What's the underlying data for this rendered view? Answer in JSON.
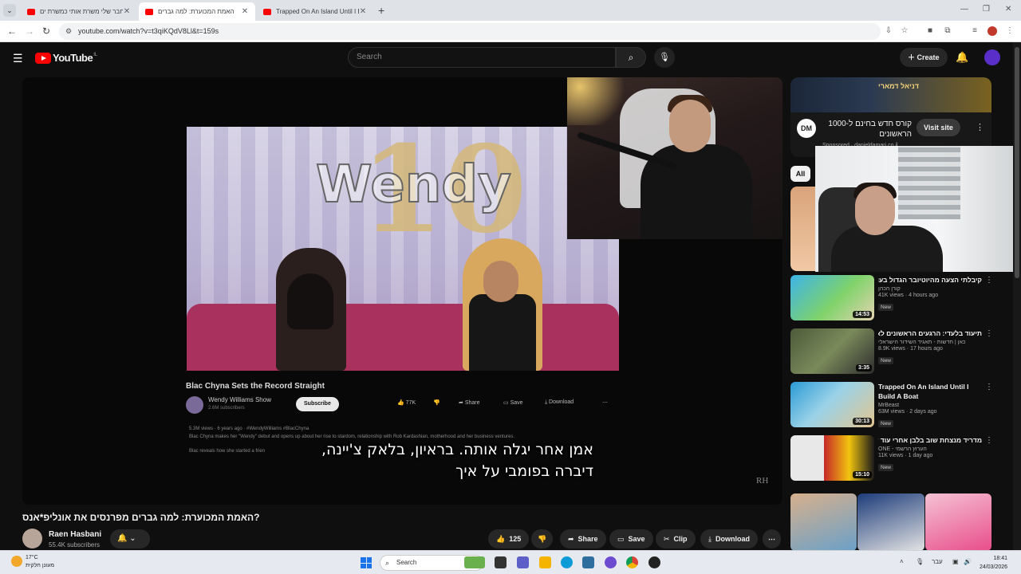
{
  "browser": {
    "tabs": [
      {
        "title": "חבר שלי משרת אותי כמשרת ים",
        "active": false
      },
      {
        "title": "האמת המכוערת: למה גברים",
        "active": true
      },
      {
        "title": "Trapped On An Island Until I Bu",
        "active": false
      }
    ],
    "url": "youtube.com/watch?v=t3qiKQdV8Ll&t=159s"
  },
  "youtube": {
    "logo_text": "YouTube",
    "country_code": "IL",
    "search_placeholder": "Search",
    "create_label": "Create"
  },
  "player": {
    "inner_video_title": "Blac Chyna Sets the Record Straight",
    "inner_channel": "Wendy Williams Show",
    "inner_subs": "2.6M subscribers",
    "inner_subscribe": "Subscribe",
    "inner_likes": "77K",
    "inner_share": "Share",
    "inner_save": "Save",
    "inner_download": "Download",
    "inner_views": "5.3M views · 6 years ago · #WendyWilliams #BlacChyna",
    "inner_desc1": "Blac Chyna makes her \"Wendy\" debut and opens up about her rise to stardom, relationship with Rob Kardashian, motherhood and her business ventures.",
    "inner_desc2": "Blac reveals how she started a frien",
    "caption_line1": "אמן אחר יגלה אותה.  בראיון, בלאק צ'יינה,",
    "caption_line2": "דיברה בפומבי על איך",
    "stage_number": "10",
    "stage_show": "Wendy",
    "watermark": "RH"
  },
  "video": {
    "title": "האמת המכוערת: למה גברים מפרנסים את אונליפ*אנס?",
    "channel": "Raen Hasbani",
    "subscribers": "55.4K subscribers",
    "likes": "125",
    "share": "Share",
    "save": "Save",
    "clip": "Clip",
    "download": "Download"
  },
  "ad": {
    "banner_text": "דניאל דמארי",
    "title": "קורס חדש בחינם ל-1000 הראשונים",
    "sponsored": "Sponsored · danieldamari.co.il",
    "logo": "DM",
    "visit": "Visit site"
  },
  "chips": {
    "all": "All"
  },
  "recommendations": [
    {
      "title": "קיבלתי הצעה מהיוטיובר הגדול בעולם! (ספוי לארצות הברית!!)",
      "channel": "קורן הכהן",
      "meta": "41K views · 4 hours ago",
      "badge": "New",
      "duration": "14:53",
      "ltr": false
    },
    {
      "title": "תיעוד בלעדי: הרגעים הראשונים לאחר הדריסה הקטלנית בשומרון",
      "channel": "כאן | חדשות - תאגיד השידור הישראלי",
      "meta": "8.9K views · 17 hours ago",
      "badge": "New",
      "duration": "3:35",
      "ltr": false
    },
    {
      "title": "Trapped On An Island Until I Build A Boat",
      "channel": "MrBeast",
      "meta": "63M views · 2 days ago",
      "badge": "New",
      "duration": "30:13",
      "ltr": true
    },
    {
      "title": "מדריד מנצחת שוב בלבן אחרי עוד דרבי מטורף בין הקבוצות! תקציר",
      "channel": "ONE - הערוץ הרשמי",
      "meta": "11K views · 1 day ago",
      "badge": "New",
      "duration": "15:10",
      "ltr": false
    }
  ],
  "taskbar": {
    "temp": "17°C",
    "weather": "מעונן חלקית",
    "search": "Search",
    "lang": "עבר",
    "time": "18:41",
    "date": "24/03/2026"
  },
  "colors": {
    "yt_red": "#ff0000",
    "bg": "#0f0f0f",
    "pill": "#272727"
  }
}
